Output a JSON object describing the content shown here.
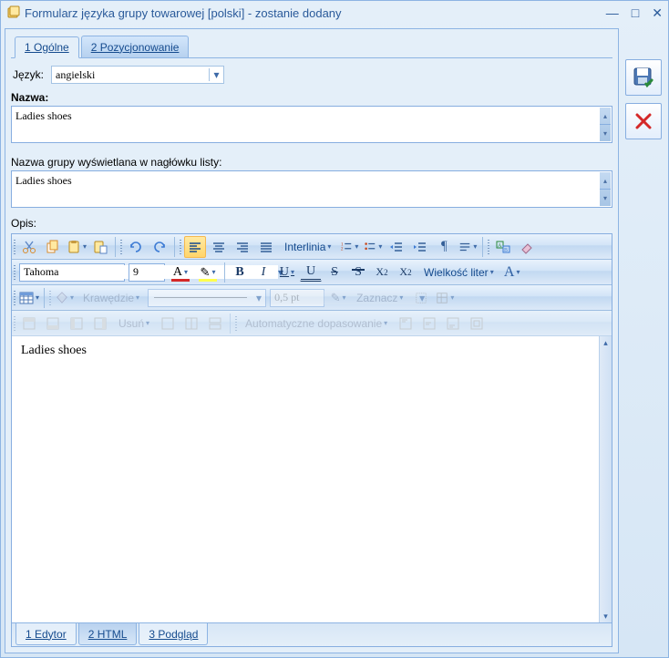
{
  "window": {
    "title": "Formularz języka grupy towarowej [polski] - zostanie dodany"
  },
  "tabs": {
    "general": "1 Ogólne",
    "positioning": "2 Pozycjonowanie"
  },
  "form": {
    "language_label": "Język:",
    "language_value": "angielski",
    "name_label": "Nazwa:",
    "name_value": "Ladies shoes",
    "header_label": "Nazwa grupy wyświetlana w nagłówku listy:",
    "header_value": "Ladies shoes",
    "desc_label": "Opis:"
  },
  "editor": {
    "font_name": "Tahoma",
    "font_size": "9",
    "interline_label": "Interlinia",
    "case_label": "Wielkość liter",
    "borders_label": "Krawędzie",
    "border_width": "0,5 pt",
    "select_label": "Zaznacz",
    "delete_label": "Usuń",
    "autofit_label": "Automatyczne dopasowanie",
    "content": "Ladies shoes"
  },
  "bottom_tabs": {
    "editor": "1 Edytor",
    "html": "2 HTML",
    "preview": "3 Podgląd"
  }
}
